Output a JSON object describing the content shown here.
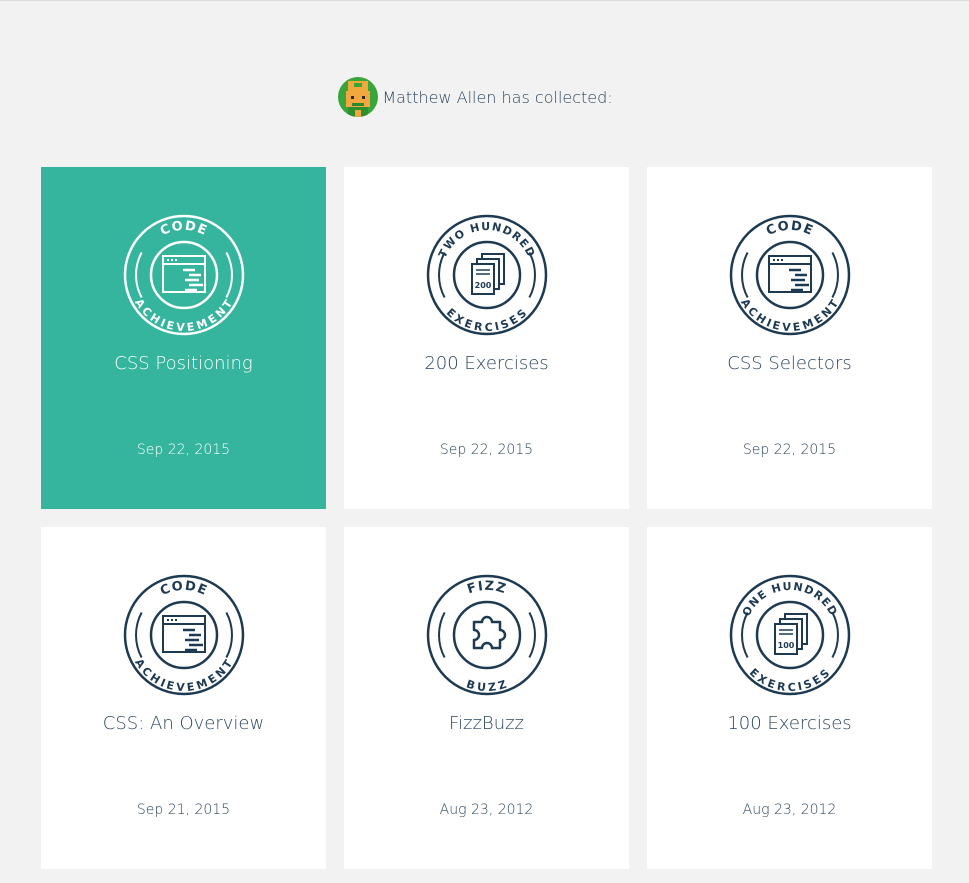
{
  "header": {
    "user_name": "Matthew Allen",
    "suffix": " has collected:"
  },
  "achievements": [
    {
      "title": "CSS Positioning",
      "date": "Sep 22, 2015",
      "badge_type": "code-achievement",
      "badge_top_text": "CODE",
      "badge_bottom_text": "ACHIEVEMENT",
      "active": true
    },
    {
      "title": "200 Exercises",
      "date": "Sep 22, 2015",
      "badge_type": "exercises",
      "badge_top_text": "TWO HUNDRED",
      "badge_bottom_text": "EXERCISES",
      "badge_number": "200",
      "active": false
    },
    {
      "title": "CSS Selectors",
      "date": "Sep 22, 2015",
      "badge_type": "code-achievement",
      "badge_top_text": "CODE",
      "badge_bottom_text": "ACHIEVEMENT",
      "active": false
    },
    {
      "title": "CSS: An Overview",
      "date": "Sep 21, 2015",
      "badge_type": "code-achievement",
      "badge_top_text": "CODE",
      "badge_bottom_text": "ACHIEVEMENT",
      "active": false
    },
    {
      "title": "FizzBuzz",
      "date": "Aug 23, 2012",
      "badge_type": "puzzle",
      "badge_top_text": "FIZZ",
      "badge_bottom_text": "BUZZ",
      "active": false
    },
    {
      "title": "100 Exercises",
      "date": "Aug 23, 2012",
      "badge_type": "exercises",
      "badge_top_text": "ONE HUNDRED",
      "badge_bottom_text": "EXERCISES",
      "badge_number": "100",
      "active": false
    }
  ],
  "colors": {
    "page_background": "#f2f2f2",
    "card_background": "#ffffff",
    "active_card_background": "#35b59e",
    "text": "#2d4660",
    "badge_stroke": "#1e3a52",
    "active_text": "#ffffff"
  }
}
